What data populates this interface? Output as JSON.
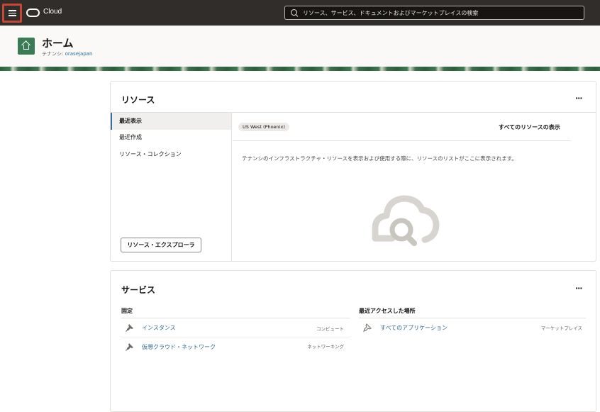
{
  "topbar": {
    "brand": "Cloud",
    "search_placeholder": "リソース、サービス、ドキュメントおよびマーケットプレイスの検索"
  },
  "header": {
    "title": "ホーム",
    "tenancy_label": "テナンシ: ",
    "tenancy_name": "orasejapan"
  },
  "resources": {
    "title": "リソース",
    "more": "···",
    "side_items": [
      "最近表示",
      "最近作成",
      "リソース・コレクション"
    ],
    "explorer_button": "リソース・エクスプローラ",
    "region": "US West (Phoenix)",
    "view_all": "すべてのリソースの表示",
    "empty_message": "テナンシのインフラストラクチャ・リソースを表示および使用する際に、リソースのリストがここに表示されます。"
  },
  "services": {
    "title": "サービス",
    "more": "···",
    "pinned_heading": "固定",
    "recent_heading": "最近アクセスした場所",
    "pinned": [
      {
        "name": "インスタンス",
        "category": "コンピュート"
      },
      {
        "name": "仮想クラウド・ネットワーク",
        "category": "ネットワーキング"
      }
    ],
    "recent": [
      {
        "name": "すべてのアプリケーション",
        "category": "マーケットプレイス"
      }
    ]
  },
  "colors": {
    "topbar": "#312d2a",
    "menu_highlight": "#c74634",
    "home_tile": "#3a7c53",
    "link": "#2b6a90"
  }
}
